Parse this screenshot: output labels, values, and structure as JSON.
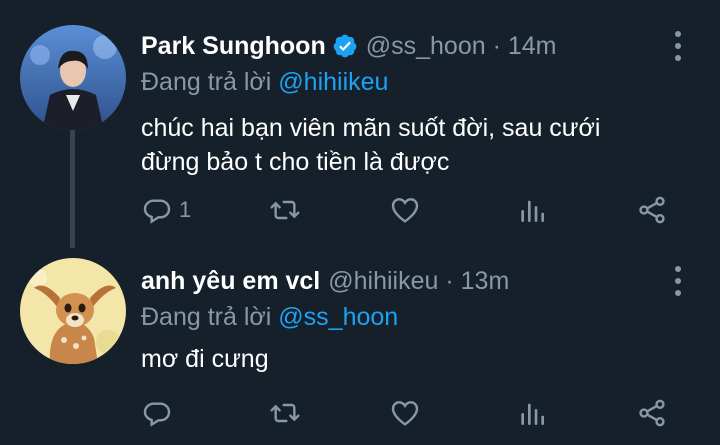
{
  "tweets": [
    {
      "name": "Park Sunghoon",
      "verified": true,
      "handle": "@ss_hoon",
      "separator": "·",
      "time": "14m",
      "replying_prefix": "Đang trả lời",
      "replying_to": "@hihiikeu",
      "text_lines": [
        "chúc hai bạn viên mãn suốt đời, sau cưới",
        "đừng bảo t cho tiền là được"
      ],
      "reply_count": "1",
      "retweet_count": "",
      "like_count": ""
    },
    {
      "name": "anh yêu em vcl",
      "verified": false,
      "handle": "@hihiikeu",
      "separator": "·",
      "time": "13m",
      "replying_prefix": "Đang trả lời",
      "replying_to": "@ss_hoon",
      "text_lines": [
        "mơ đi cưng"
      ],
      "reply_count": "",
      "retweet_count": "",
      "like_count": ""
    }
  ],
  "colors": {
    "background": "#15202b",
    "secondary_text": "#8899a6",
    "link": "#1da1f2",
    "thread_line": "#38444d"
  },
  "icons": [
    "more-vertical-icon",
    "verified-badge-icon",
    "reply-icon",
    "retweet-icon",
    "like-icon",
    "analytics-icon",
    "share-icon"
  ]
}
